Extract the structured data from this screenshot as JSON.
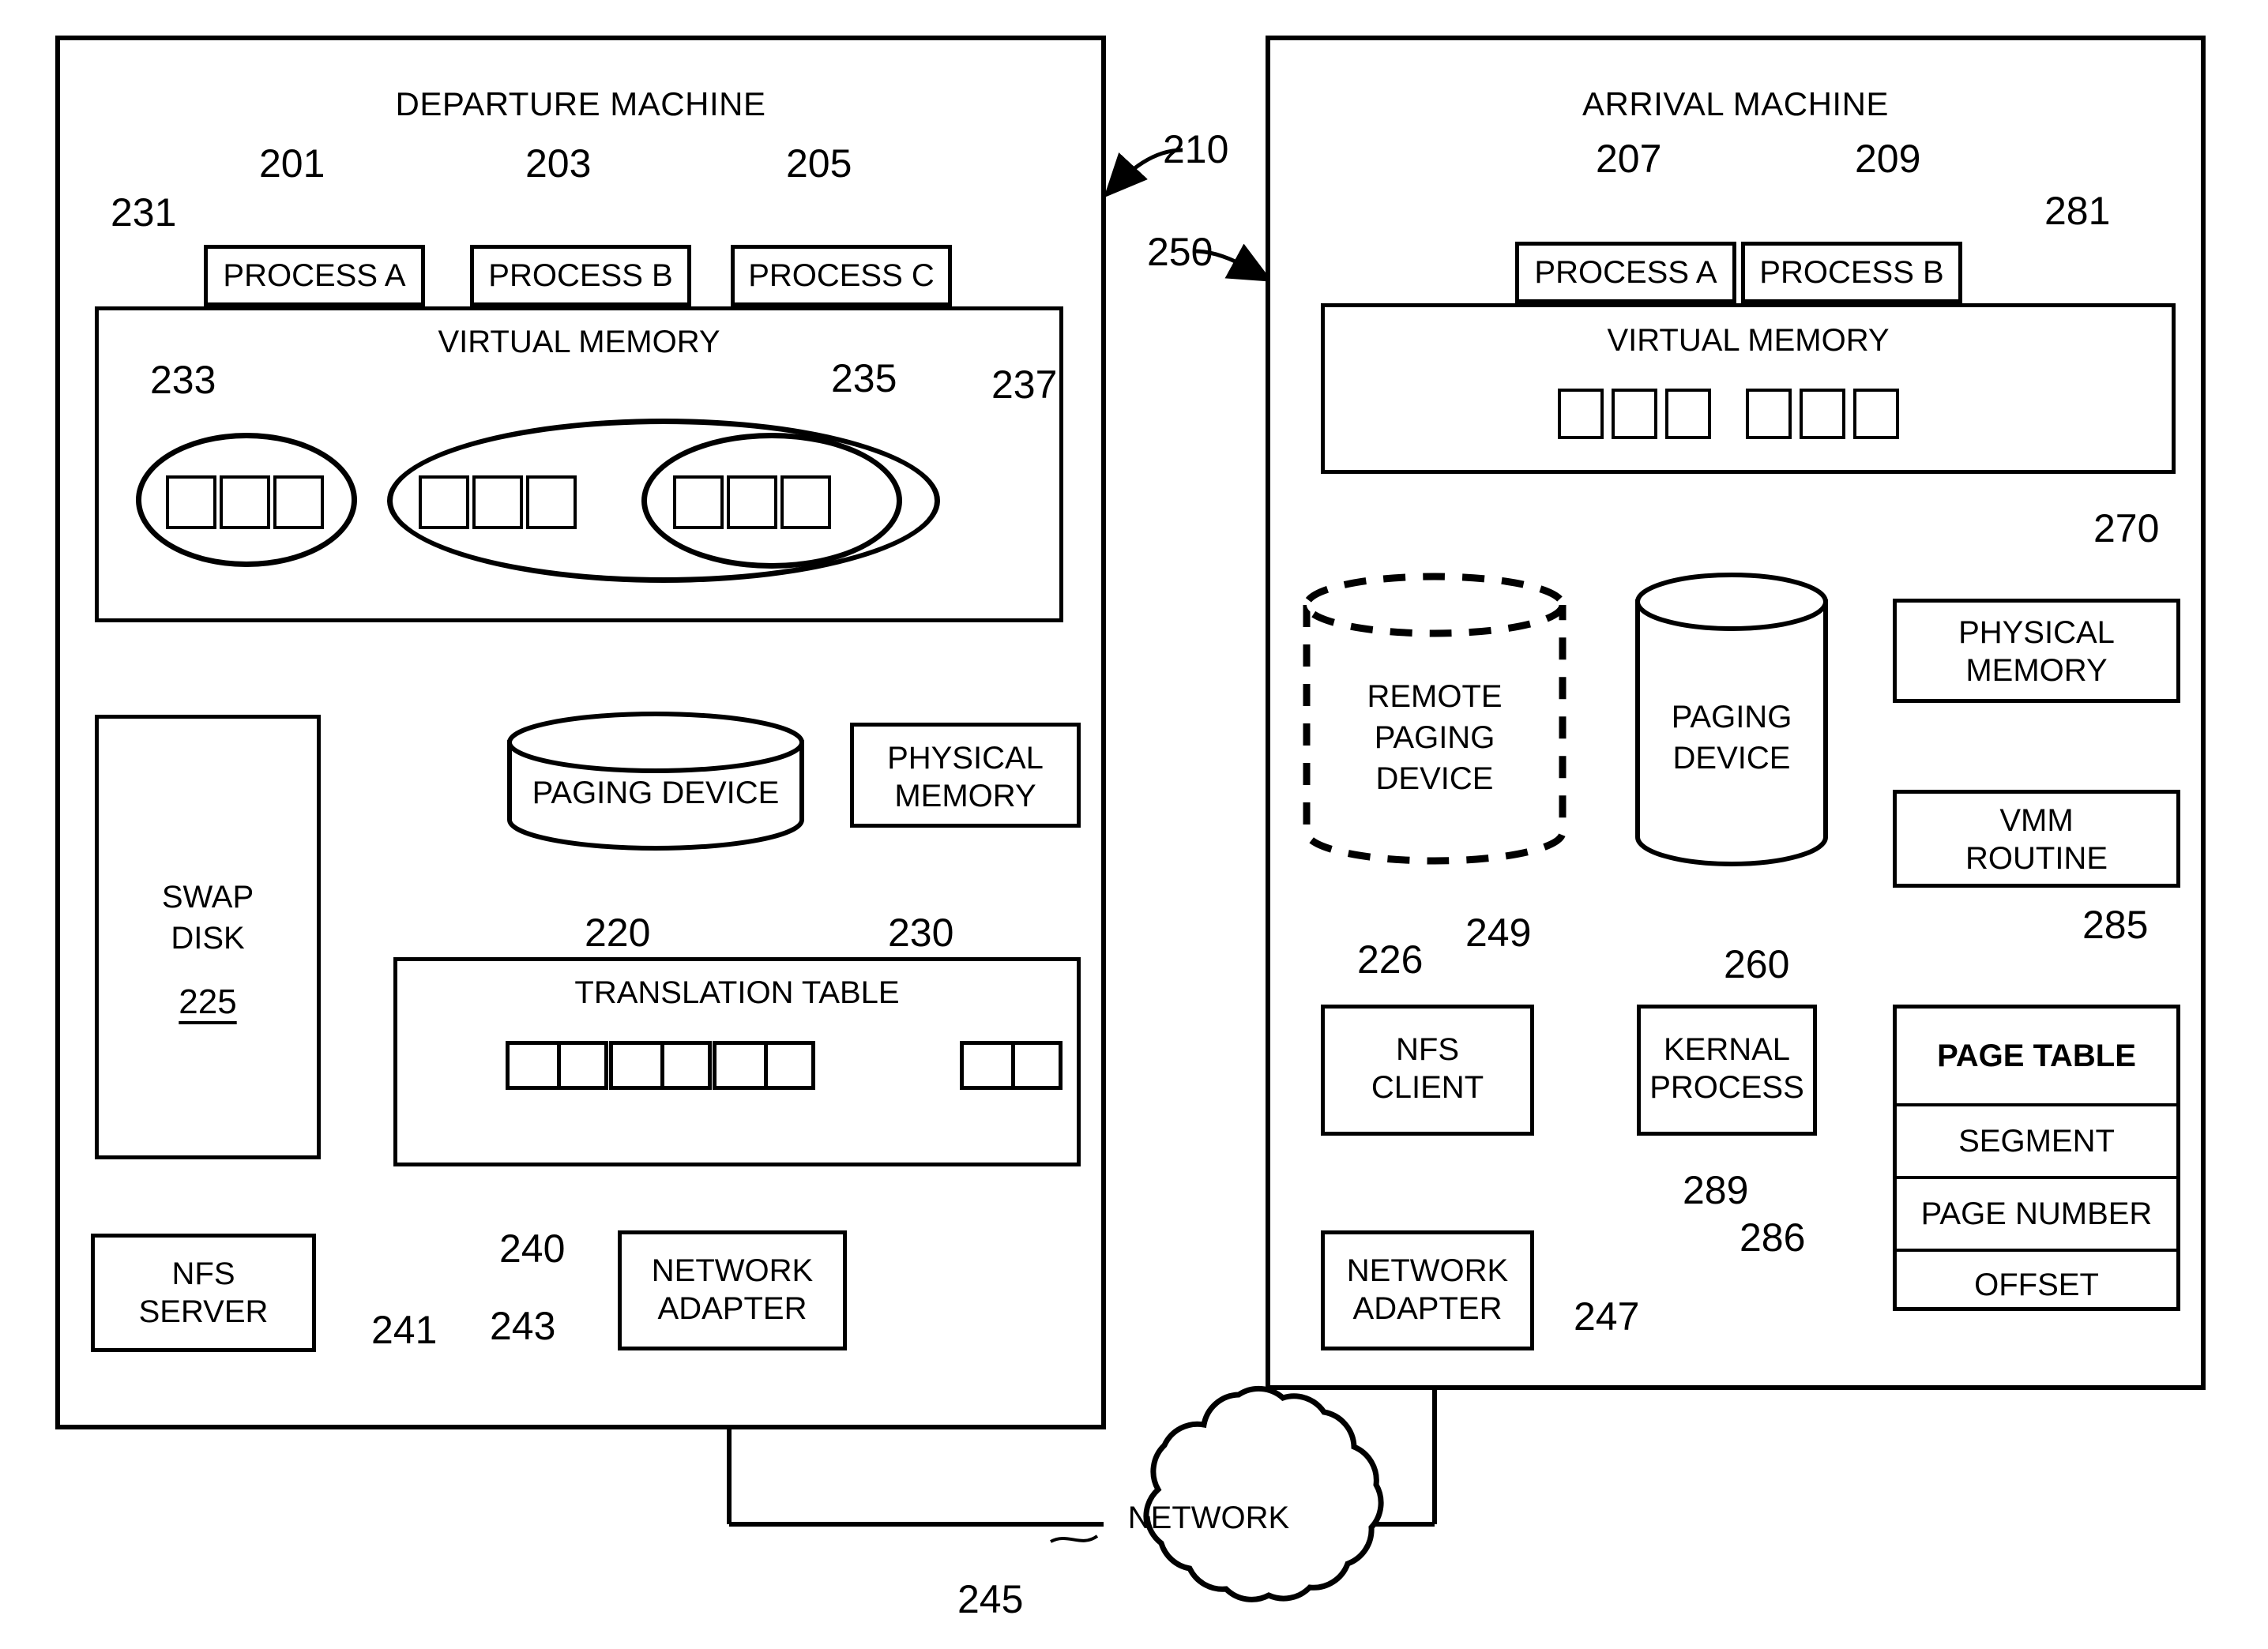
{
  "figure": {
    "departure_machine": {
      "title": "DEPARTURE MACHINE",
      "ref": "210",
      "processes": [
        {
          "label": "PROCESS A",
          "ref": "201"
        },
        {
          "label": "PROCESS B",
          "ref": "203"
        },
        {
          "label": "PROCESS C",
          "ref": "205"
        }
      ],
      "virtual_memory": {
        "label": "VIRTUAL MEMORY",
        "ref": "231",
        "groups": [
          {
            "ref": "233",
            "pages": 3
          },
          {
            "ref": "235",
            "pages": 6
          },
          {
            "ref": "237",
            "pages": 3
          }
        ]
      },
      "swap_disk": {
        "label_line1": "SWAP",
        "label_line2": "DISK",
        "ref": "225"
      },
      "paging_device": {
        "label": "PAGING DEVICE",
        "ref": "220"
      },
      "physical_memory": {
        "label_line1": "PHYSICAL",
        "label_line2": "MEMORY",
        "ref": "230"
      },
      "translation_table": {
        "label": "TRANSLATION TABLE",
        "ref": "240",
        "ellipsis": "o o o",
        "cells": 4
      },
      "nfs_server": {
        "label_line1": "NFS",
        "label_line2": "SERVER",
        "ref": "241"
      },
      "network_adapter": {
        "label_line1": "NETWORK",
        "label_line2": "ADAPTER",
        "ref": "243"
      }
    },
    "arrival_machine": {
      "title": "ARRIVAL MACHINE",
      "ref": "250",
      "processes": [
        {
          "label": "PROCESS A",
          "ref": "207"
        },
        {
          "label": "PROCESS B",
          "ref": "209"
        }
      ],
      "virtual_memory": {
        "label": "VIRTUAL MEMORY",
        "ref": "281",
        "group_a_pages": 3,
        "group_b_pages": 3
      },
      "remote_paging_device": {
        "label_line1": "REMOTE",
        "label_line2": "PAGING",
        "label_line3": "DEVICE",
        "ref": "226"
      },
      "paging_device": {
        "label_line1": "PAGING",
        "label_line2": "DEVICE",
        "ref": "260"
      },
      "physical_memory": {
        "label_line1": "PHYSICAL",
        "label_line2": "MEMORY",
        "ref": "270"
      },
      "vmm_routine": {
        "label_line1": "VMM",
        "label_line2": "ROUTINE",
        "ref": "285"
      },
      "page_table": {
        "ref": "286",
        "rows": [
          "PAGE TABLE",
          "SEGMENT",
          "PAGE NUMBER",
          "OFFSET"
        ]
      },
      "nfs_client": {
        "label_line1": "NFS",
        "label_line2": "CLIENT",
        "ref": "249"
      },
      "kernal_process": {
        "label_line1": "KERNAL",
        "label_line2": "PROCESS",
        "ref": "289"
      },
      "network_adapter": {
        "label_line1": "NETWORK",
        "label_line2": "ADAPTER",
        "ref": "247"
      }
    },
    "network": {
      "label": "NETWORK",
      "ref": "245"
    }
  }
}
